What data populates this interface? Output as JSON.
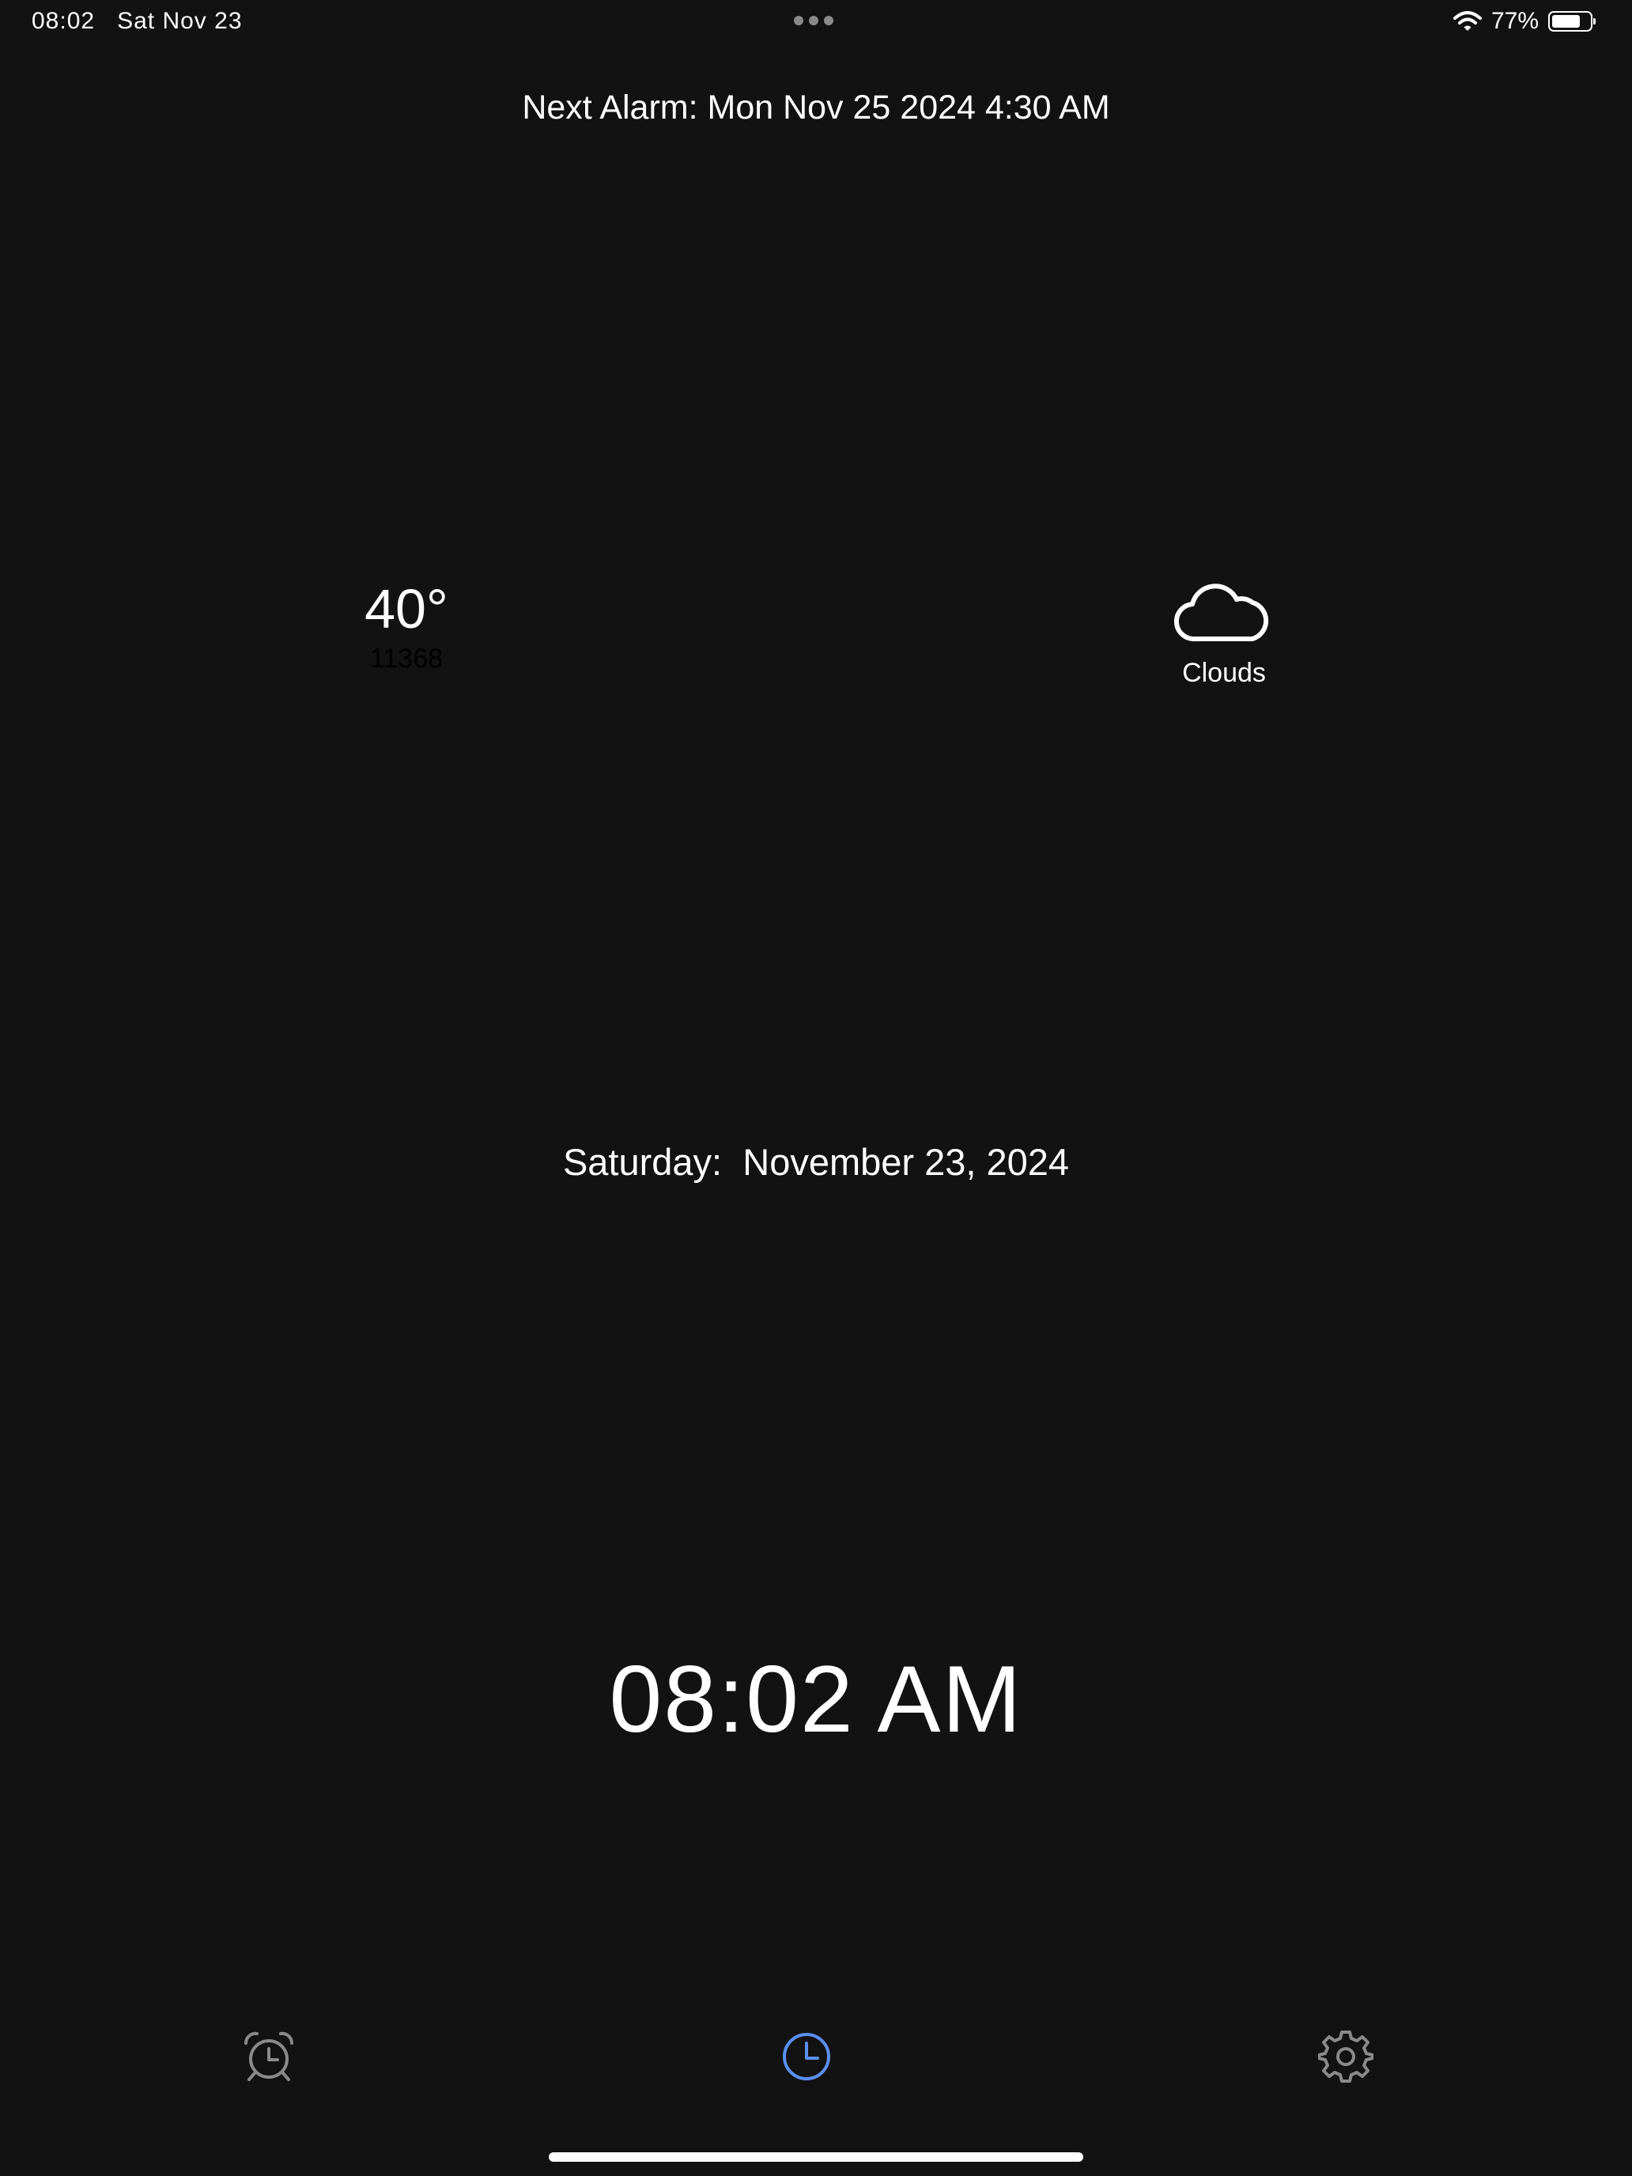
{
  "status_bar": {
    "time": "08:02",
    "date": "Sat Nov 23",
    "battery_percent": "77%",
    "battery_level": 0.77
  },
  "next_alarm": "Next Alarm: Mon Nov 25 2024 4:30 AM",
  "weather": {
    "temperature": "40°",
    "code": "11368",
    "condition": "Clouds",
    "icon": "cloud-icon"
  },
  "date": {
    "weekday": "Saturday:",
    "full": "November 23, 2024"
  },
  "clock": {
    "time": "08:02 AM"
  },
  "tabs": [
    {
      "icon": "alarm-clock-icon",
      "active": false
    },
    {
      "icon": "clock-icon",
      "active": true
    },
    {
      "icon": "gear-icon",
      "active": false
    }
  ],
  "colors": {
    "background": "#121212",
    "text": "#ffffff",
    "active_tab": "#5b8ff0",
    "inactive_tab": "#8a8a8a"
  }
}
